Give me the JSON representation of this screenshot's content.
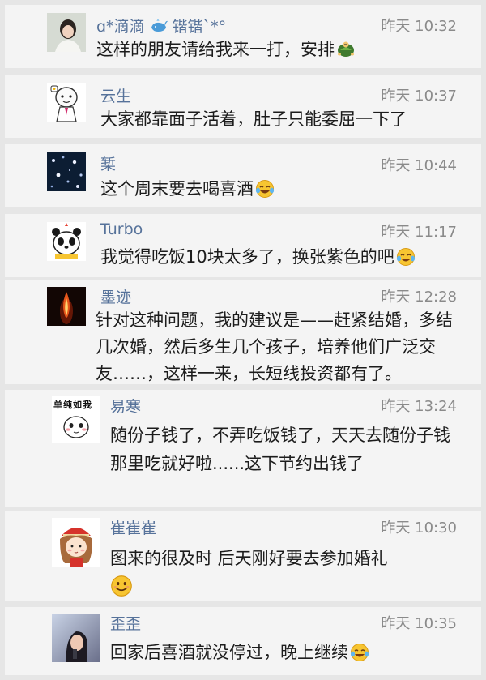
{
  "comments": [
    {
      "name": "ɑ*滴滴",
      "name_suffix": "锴锴`*°",
      "time": "昨天 10:32",
      "text": "这样的朋友请给我来一打，安排"
    },
    {
      "name": "云生",
      "time": "昨天 10:37",
      "text": "大家都靠面子活着，肚子只能委屈一下了"
    },
    {
      "name": "椠",
      "time": "昨天 10:44",
      "text": "这个周末要去喝喜酒"
    },
    {
      "name": "Turbo",
      "time": "昨天 11:17",
      "text": "我觉得吃饭10块太多了，换张紫色的吧"
    },
    {
      "name": "墨迹",
      "time": "昨天 12:28",
      "text": "针对这种问题，我的建议是——赶紧结婚，多结几次婚，然后多生几个孩子，培养他们广泛交友……，这样一来，长短线投资都有了。"
    },
    {
      "name": "易寒",
      "time": "昨天 13:24",
      "avatar_caption": "单纯如我",
      "text": "随份子钱了，不弄吃饭钱了，天天去随份子钱那里吃就好啦......这下节约出钱了"
    },
    {
      "name": "崔崔崔",
      "time": "昨天 10:30",
      "text": "图来的很及时 后天刚好要去参加婚礼"
    },
    {
      "name": "歪歪",
      "time": "昨天 10:35",
      "text": "回家后喜酒就没停过，晚上继续"
    }
  ],
  "colors": {
    "background": "#e6e6e6",
    "card": "#f4f4f4",
    "name": "#56729a",
    "time": "#8a8a8a",
    "text": "#1c1c1c"
  },
  "icons": [
    "whale-icon",
    "turtle-emoji-icon",
    "crying-laugh-emoji-icon",
    "smile-emoji-icon"
  ]
}
